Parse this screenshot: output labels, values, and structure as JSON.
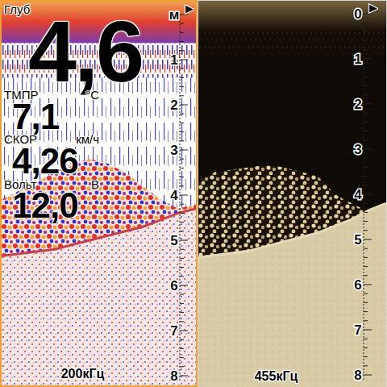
{
  "panels": [
    {
      "frequency": "200кГц",
      "selected": true,
      "kind": "color",
      "marker": "▶",
      "scale_labels": [
        "м",
        "1",
        "2",
        "3",
        "4",
        "5",
        "6",
        "7",
        "8"
      ],
      "clutter_m": 1.4,
      "cover_top_m": [
        4.1,
        3.9,
        3.7,
        3.5,
        3.3,
        3.2,
        3.3,
        3.5,
        3.8,
        4.1,
        4.3,
        4.2
      ],
      "bottom_depth_m": [
        5.35,
        5.3,
        5.25,
        5.2,
        5.1,
        5.0,
        4.9,
        4.8,
        4.7,
        4.55,
        4.4,
        4.3
      ],
      "readings": [
        {
          "label": "Глуб",
          "value": "4,6",
          "kind": "large"
        },
        {
          "label": "ТМПР",
          "unit": "°С",
          "value": "7,1",
          "kind": "small"
        },
        {
          "label": "СКОР",
          "unit": "км/ч",
          "value": "4,26",
          "kind": "small"
        },
        {
          "label": "Вольт",
          "unit": "В",
          "value": "12,0",
          "kind": "small"
        }
      ]
    },
    {
      "frequency": "455кГц",
      "selected": false,
      "kind": "amber",
      "marker": "▶",
      "scale_labels": [
        "0",
        "1",
        "2",
        "3",
        "4",
        "5",
        "6",
        "7",
        "8"
      ],
      "clutter_m": 0.9,
      "cover_top_m": [
        3.7,
        3.5,
        3.45,
        3.4,
        3.35,
        3.4,
        3.5,
        3.6,
        4.0,
        4.2,
        4.4,
        4.3
      ],
      "bottom_depth_m": [
        5.4,
        5.35,
        5.3,
        5.25,
        5.15,
        5.05,
        4.95,
        4.85,
        4.7,
        4.55,
        4.35,
        4.2
      ],
      "readings": []
    }
  ]
}
